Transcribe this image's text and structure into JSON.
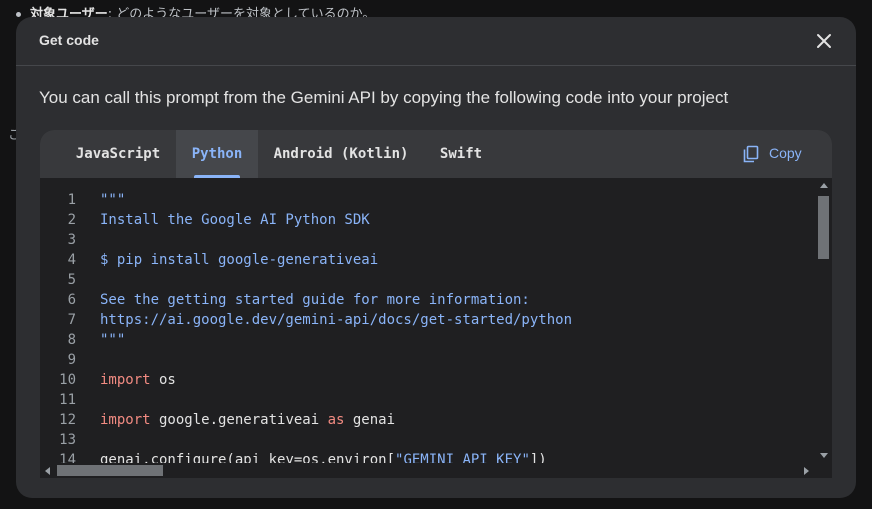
{
  "background": {
    "bullet_bold": "対象ユーザー",
    "bullet_rest": ": どのようなユーザーを対象としているのか。",
    "side_char": "こ"
  },
  "dialog": {
    "title": "Get code",
    "close_icon": "close-icon",
    "description": "You can call this prompt from the Gemini API by copying the following code into your project"
  },
  "tabs": [
    {
      "label": "JavaScript",
      "active": false
    },
    {
      "label": "Python",
      "active": true
    },
    {
      "label": "Android (Kotlin)",
      "active": false
    },
    {
      "label": "Swift",
      "active": false
    }
  ],
  "copy": {
    "label": "Copy",
    "icon": "copy-icon"
  },
  "colors": {
    "accent": "#8ab4f8",
    "keyword": "#f28b82",
    "dialog_bg": "#2d2e31",
    "code_bg": "#1f1f21"
  },
  "code_lines": [
    {
      "n": "1",
      "tokens": [
        {
          "t": "\"\"\"",
          "k": "str"
        }
      ]
    },
    {
      "n": "2",
      "tokens": [
        {
          "t": "Install the Google AI Python SDK",
          "k": "str"
        }
      ]
    },
    {
      "n": "3",
      "tokens": []
    },
    {
      "n": "4",
      "tokens": [
        {
          "t": "$ pip install google-generativeai",
          "k": "str"
        }
      ]
    },
    {
      "n": "5",
      "tokens": []
    },
    {
      "n": "6",
      "tokens": [
        {
          "t": "See the getting started guide for more information:",
          "k": "str"
        }
      ]
    },
    {
      "n": "7",
      "tokens": [
        {
          "t": "https://ai.google.dev/gemini-api/docs/get-started/python",
          "k": "str"
        }
      ]
    },
    {
      "n": "8",
      "tokens": [
        {
          "t": "\"\"\"",
          "k": "str"
        }
      ]
    },
    {
      "n": "9",
      "tokens": []
    },
    {
      "n": "10",
      "tokens": [
        {
          "t": "import",
          "k": "kw"
        },
        {
          "t": " os",
          "k": "id"
        }
      ]
    },
    {
      "n": "11",
      "tokens": []
    },
    {
      "n": "12",
      "tokens": [
        {
          "t": "import",
          "k": "kw"
        },
        {
          "t": " google.generativeai ",
          "k": "id"
        },
        {
          "t": "as",
          "k": "kw"
        },
        {
          "t": " genai",
          "k": "id"
        }
      ]
    },
    {
      "n": "13",
      "tokens": []
    },
    {
      "n": "14",
      "tokens": [
        {
          "t": "genai.configure(api_key=os.environ[",
          "k": "id"
        },
        {
          "t": "\"GEMINI_API_KEY\"",
          "k": "str"
        },
        {
          "t": "])",
          "k": "id"
        }
      ]
    }
  ]
}
